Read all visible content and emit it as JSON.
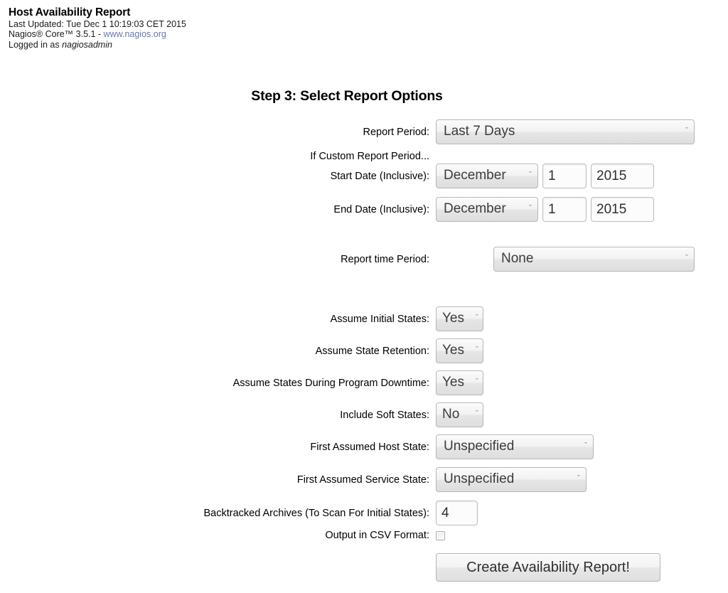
{
  "header": {
    "title": "Host Availability Report",
    "last_updated": "Last Updated: Tue Dec 1 10:19:03 CET 2015",
    "product_prefix": "Nagios® Core™ 3.5.1 - ",
    "product_link": "www.nagios.org",
    "logged_in_prefix": "Logged in as ",
    "logged_in_user": "nagiosadmin"
  },
  "step_title": "Step 3: Select Report Options",
  "form": {
    "report_period": {
      "label": "Report Period:",
      "value": "Last 7 Days"
    },
    "custom_period_note": "If Custom Report Period...",
    "start_date": {
      "label": "Start Date (Inclusive):",
      "month": "December",
      "day": "1",
      "year": "2015"
    },
    "end_date": {
      "label": "End Date (Inclusive):",
      "month": "December",
      "day": "1",
      "year": "2015"
    },
    "report_time_period": {
      "label": "Report time Period:",
      "value": "None"
    },
    "assume_initial_states": {
      "label": "Assume Initial States:",
      "value": "Yes"
    },
    "assume_state_retention": {
      "label": "Assume State Retention:",
      "value": "Yes"
    },
    "assume_states_during_downtime": {
      "label": "Assume States During Program Downtime:",
      "value": "Yes"
    },
    "include_soft_states": {
      "label": "Include Soft States:",
      "value": "No"
    },
    "first_assumed_host_state": {
      "label": "First Assumed Host State:",
      "value": "Unspecified"
    },
    "first_assumed_service_state": {
      "label": "First Assumed Service State:",
      "value": "Unspecified"
    },
    "backtracked_archives": {
      "label": "Backtracked Archives (To Scan For Initial States):",
      "value": "4"
    },
    "output_csv": {
      "label": "Output in CSV Format:",
      "checked": false
    },
    "submit_label": "Create Availability Report!"
  },
  "icons": {
    "chevron_down": "ˇ"
  },
  "colors": {
    "link": "#6878a8",
    "text": "#000000",
    "background": "#ffffff",
    "control_border": "#b6b6b6"
  }
}
